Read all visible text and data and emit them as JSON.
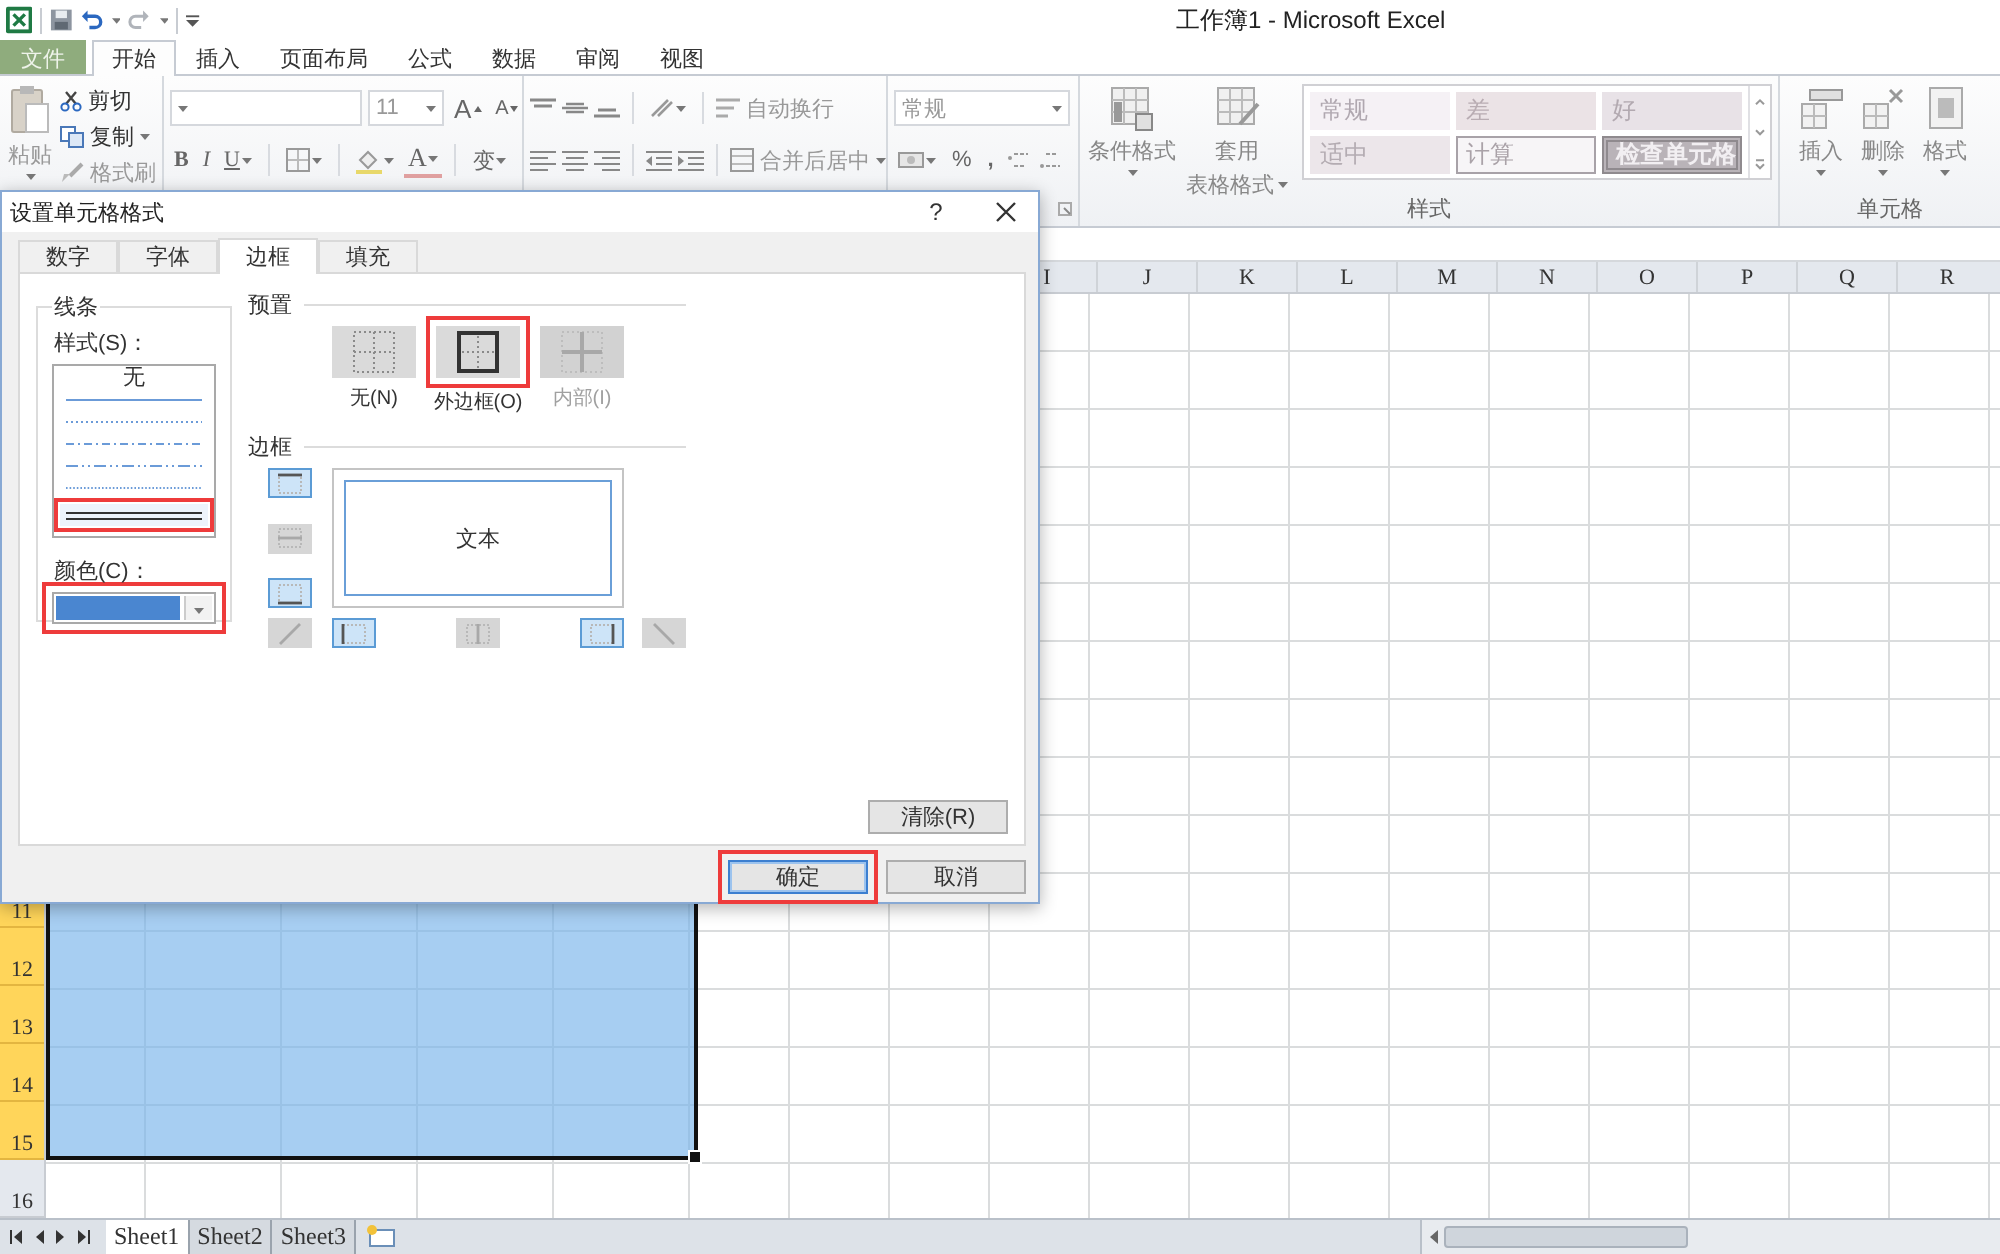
{
  "window": {
    "title": "工作簿1 - Microsoft Excel"
  },
  "ribbon_tabs": [
    {
      "label": "文件",
      "kind": "file",
      "selected": false
    },
    {
      "label": "开始",
      "kind": "tab",
      "selected": true
    },
    {
      "label": "插入",
      "kind": "tab",
      "selected": false
    },
    {
      "label": "页面布局",
      "kind": "tab",
      "selected": false
    },
    {
      "label": "公式",
      "kind": "tab",
      "selected": false
    },
    {
      "label": "数据",
      "kind": "tab",
      "selected": false
    },
    {
      "label": "审阅",
      "kind": "tab",
      "selected": false
    },
    {
      "label": "视图",
      "kind": "tab",
      "selected": false
    }
  ],
  "clipboard": {
    "paste": {
      "label": "粘贴",
      "disabled": true
    },
    "cut": {
      "label": "剪切",
      "disabled": false
    },
    "copy": {
      "label": "复制",
      "disabled": false
    },
    "format_painter": {
      "label": "格式刷",
      "disabled": true
    }
  },
  "font": {
    "size": "11",
    "grow": "A",
    "shrink": "A",
    "bold": "B",
    "italic": "I",
    "underline": "U",
    "font_color": "A",
    "phonetic": "变"
  },
  "alignment": {
    "wrap_text": "自动换行",
    "merge_center": "合并后居中"
  },
  "number": {
    "format": "常规",
    "percent": "%",
    "comma": ","
  },
  "styles": {
    "conditional_format": "条件格式",
    "table_format_1": "套用",
    "table_format_2": "表格格式",
    "group_label": "样式",
    "cell_styles": [
      {
        "label": "常规",
        "kind": "normal"
      },
      {
        "label": "差",
        "kind": "bad"
      },
      {
        "label": "好",
        "kind": "good"
      },
      {
        "label": "适中",
        "kind": "neutral"
      },
      {
        "label": "计算",
        "kind": "calc"
      },
      {
        "label": "检查单元格",
        "kind": "check"
      }
    ]
  },
  "cells": {
    "insert": "插入",
    "delete": "删除",
    "format": "格式",
    "group_label": "单元格"
  },
  "sheet": {
    "column_headers": [
      "I",
      "J",
      "K",
      "L",
      "M",
      "N",
      "O",
      "P",
      "Q",
      "R"
    ],
    "row_headers": [
      {
        "label": "11",
        "selected": true
      },
      {
        "label": "12",
        "selected": true
      },
      {
        "label": "13",
        "selected": true
      },
      {
        "label": "14",
        "selected": true
      },
      {
        "label": "15",
        "selected": true
      },
      {
        "label": "16",
        "selected": false
      }
    ],
    "tabs": [
      {
        "label": "Sheet1",
        "selected": true
      },
      {
        "label": "Sheet2",
        "selected": false
      },
      {
        "label": "Sheet3",
        "selected": false
      }
    ]
  },
  "dialog": {
    "title": "设置单元格格式",
    "help": "?",
    "tabs": [
      {
        "label": "数字",
        "selected": false
      },
      {
        "label": "字体",
        "selected": false
      },
      {
        "label": "边框",
        "selected": true
      },
      {
        "label": "填充",
        "selected": false
      }
    ],
    "line": {
      "group_label": "线条",
      "style_label": "样式(S)：",
      "color_label": "颜色(C)：",
      "color": "#4a86d0",
      "color_highlighted": true,
      "styles": [
        {
          "kind": "none",
          "label": "无",
          "selected": false,
          "highlighted": false
        },
        {
          "kind": "hair",
          "selected": false,
          "highlighted": false
        },
        {
          "kind": "dotted",
          "selected": false,
          "highlighted": false
        },
        {
          "kind": "dash-dot",
          "selected": false,
          "highlighted": false
        },
        {
          "kind": "dash-dot-long",
          "selected": false,
          "highlighted": false
        },
        {
          "kind": "dotted-fine",
          "selected": false,
          "highlighted": false
        },
        {
          "kind": "double",
          "selected": true,
          "highlighted": true
        }
      ]
    },
    "presets": {
      "label": "预置",
      "items": [
        {
          "kind": "none",
          "label": "无(N)",
          "disabled": false,
          "highlighted": false
        },
        {
          "kind": "outline",
          "label": "外边框(O)",
          "disabled": false,
          "highlighted": true
        },
        {
          "kind": "inside",
          "label": "内部(I)",
          "disabled": true,
          "highlighted": false
        }
      ]
    },
    "border": {
      "label": "边框",
      "preview_text": "文本",
      "side_buttons": [
        {
          "kind": "top",
          "on": true,
          "disabled": false
        },
        {
          "kind": "middle",
          "on": false,
          "disabled": true
        },
        {
          "kind": "bottom",
          "on": true,
          "disabled": false
        }
      ],
      "bottom_buttons": [
        {
          "kind": "diagonal-up",
          "on": false,
          "disabled": true
        },
        {
          "kind": "left",
          "on": true,
          "disabled": false
        },
        {
          "kind": "center",
          "on": false,
          "disabled": true
        },
        {
          "kind": "right",
          "on": true,
          "disabled": false
        },
        {
          "kind": "diagonal-down",
          "on": false,
          "disabled": true
        }
      ]
    },
    "clear": "清除(R)",
    "ok": {
      "label": "确定",
      "highlighted": true
    },
    "cancel": "取消"
  }
}
